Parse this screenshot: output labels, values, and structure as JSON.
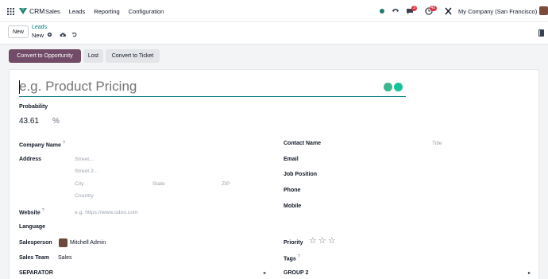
{
  "navbar": {
    "app_name": "CRM",
    "menu": [
      "Sales",
      "Leads",
      "Reporting",
      "Configuration"
    ],
    "chat_badge": "3",
    "activity_badge": "42",
    "company": "My Company (San Francisco)"
  },
  "control": {
    "new_label": "New",
    "breadcrumb_parent": "Leads",
    "breadcrumb_current": "New"
  },
  "actions": {
    "convert_opportunity": "Convert to Opportunity",
    "lost": "Lost",
    "convert_ticket": "Convert to Ticket"
  },
  "form": {
    "title_placeholder": "e.g. Product Pricing",
    "probability_label": "Probability",
    "probability_value": "43.61",
    "probability_unit": "%",
    "company_name_label": "Company Name",
    "address_label": "Address",
    "street_placeholder": "Street...",
    "street2_placeholder": "Street 2...",
    "city_placeholder": "City",
    "state_placeholder": "State",
    "zip_placeholder": "ZIP",
    "country_placeholder": "Country",
    "website_label": "Website",
    "website_placeholder": "e.g. https://www.odoo.com",
    "language_label": "Language",
    "salesperson_label": "Salesperson",
    "salesperson_value": "Mitchell Admin",
    "sales_team_label": "Sales Team",
    "sales_team_value": "Sales",
    "contact_name_label": "Contact Name",
    "title_field_placeholder": "Title",
    "email_label": "Email",
    "job_position_label": "Job Position",
    "phone_label": "Phone",
    "mobile_label": "Mobile",
    "priority_label": "Priority",
    "priority_stars": 0,
    "tags_label": "Tags",
    "help_mark": "?",
    "separator_label": "SEPARATOR",
    "group2_label": "GROUP 2"
  },
  "colors": {
    "brand": "#714b67",
    "accent": "#017e84",
    "badge": "#dc3545"
  }
}
